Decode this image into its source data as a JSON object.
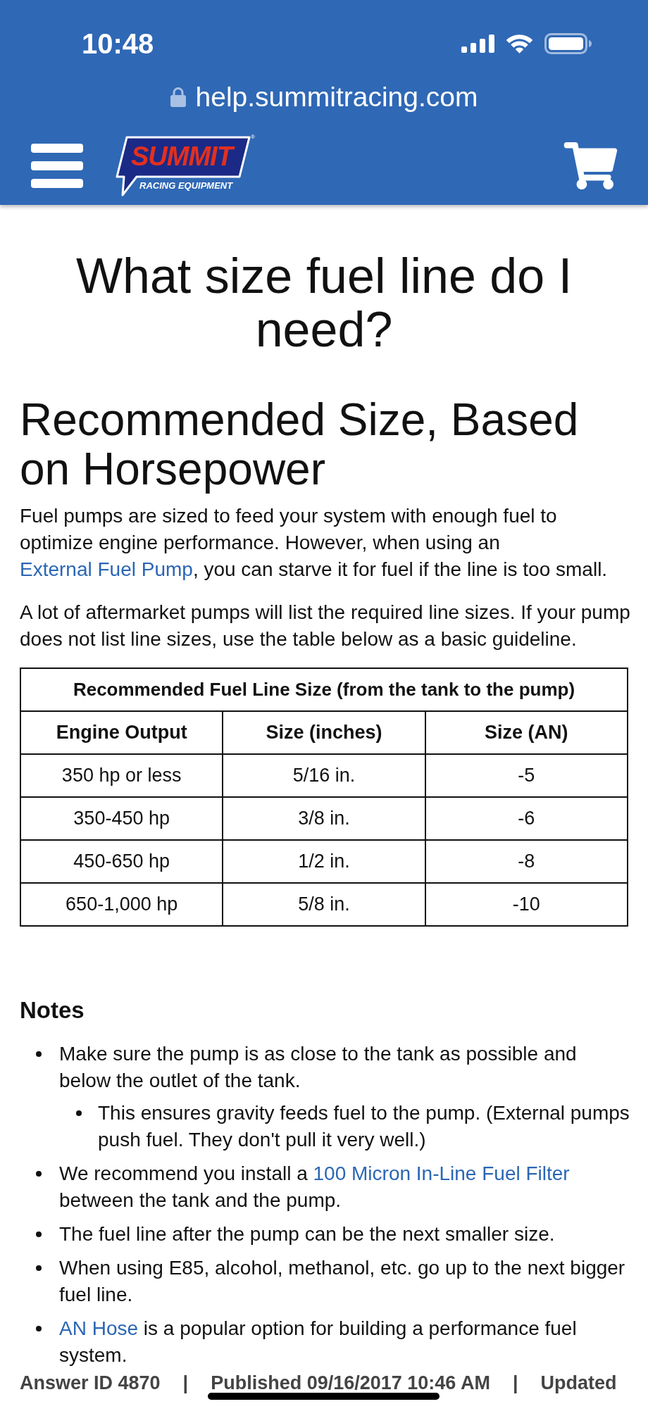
{
  "status_bar": {
    "time": "10:48"
  },
  "address_bar": {
    "url": "help.summitracing.com"
  },
  "nav": {
    "logo": {
      "wordmark": "SUMMIT",
      "tagline": "RACING EQUIPMENT",
      "registered_mark": "®"
    }
  },
  "article": {
    "title": "What size fuel line do I need?",
    "section_heading": "Recommended Size, Based on Horsepower",
    "paragraphs": [
      {
        "segments": [
          {
            "kind": "text",
            "text": "Fuel pumps are sized to feed your system with enough fuel to optimize engine performance. However, when using an "
          },
          {
            "kind": "link",
            "text": "External Fuel Pump"
          },
          {
            "kind": "text",
            "text": ", you can starve it for fuel if the line is too small."
          }
        ]
      },
      {
        "segments": [
          {
            "kind": "text",
            "text": "A lot of aftermarket pumps will list the required line sizes. If your pump does not list line sizes, use the table below as a basic guideline."
          }
        ]
      }
    ],
    "table": {
      "title": "Recommended Fuel Line Size (from the tank to the pump)",
      "columns": [
        "Engine Output",
        "Size (inches)",
        "Size (AN)"
      ],
      "rows": [
        [
          "350 hp or less",
          "5/16 in.",
          "-5"
        ],
        [
          "350-450 hp",
          "3/8 in.",
          "-6"
        ],
        [
          "450-650 hp",
          "1/2 in.",
          "-8"
        ],
        [
          "650-1,000 hp",
          "5/8 in.",
          "-10"
        ]
      ]
    },
    "notes": {
      "heading": "Notes",
      "items": [
        {
          "segments": [
            {
              "kind": "text",
              "text": "Make sure the pump is as close to the tank as possible and below the outlet of the tank."
            }
          ],
          "children": [
            {
              "segments": [
                {
                  "kind": "text",
                  "text": "This ensures gravity feeds fuel to the pump. (External pumps push fuel. They don't pull it very well.)"
                }
              ]
            }
          ]
        },
        {
          "segments": [
            {
              "kind": "text",
              "text": "We recommend you install a "
            },
            {
              "kind": "link",
              "text": "100 Micron In-Line Fuel Filter"
            },
            {
              "kind": "text",
              "text": " between the tank and the pump."
            }
          ]
        },
        {
          "segments": [
            {
              "kind": "text",
              "text": "The fuel line after the pump can be the next smaller size."
            }
          ]
        },
        {
          "segments": [
            {
              "kind": "text",
              "text": "When using E85, alcohol, methanol, etc. go up to the next bigger fuel line."
            }
          ]
        },
        {
          "segments": [
            {
              "kind": "link",
              "text": "AN Hose"
            },
            {
              "kind": "text",
              "text": " is a popular option for building a performance fuel system."
            }
          ]
        }
      ]
    }
  },
  "footer": {
    "meta": [
      "Answer ID 4870",
      "|",
      "Published 09/16/2017 10:46 AM",
      "|",
      "Updated"
    ]
  }
}
